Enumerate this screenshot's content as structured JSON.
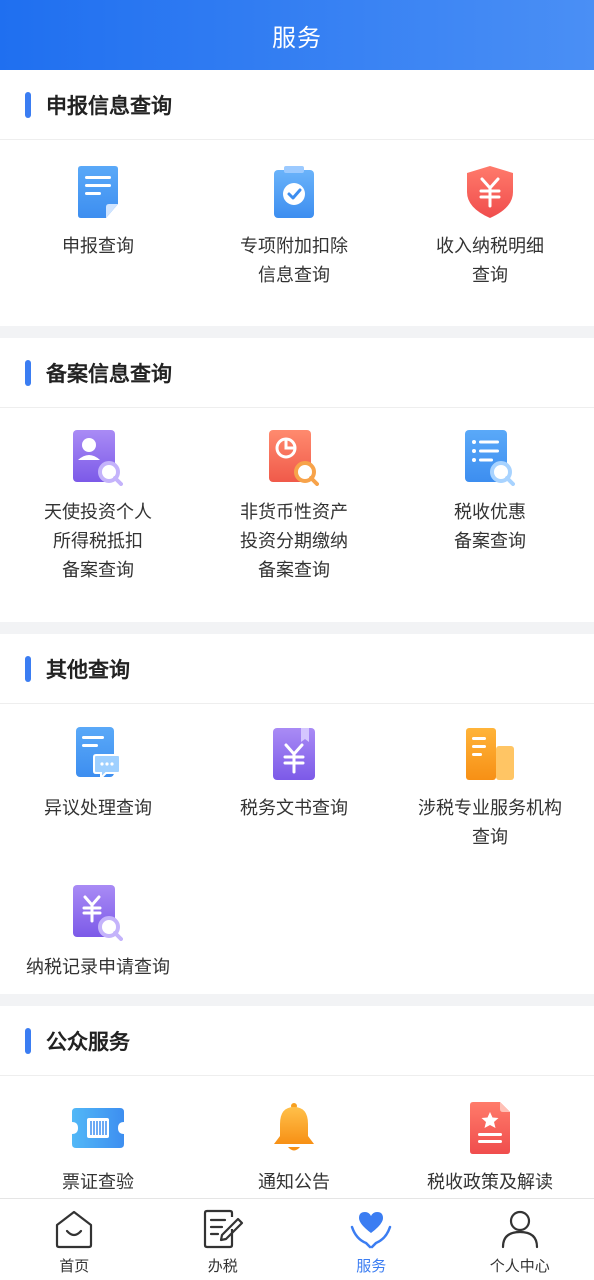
{
  "header": {
    "title": "服务"
  },
  "sections": [
    {
      "title": "申报信息查询",
      "items": [
        {
          "label": "申报查询",
          "icon": "document-icon"
        },
        {
          "label": "专项附加扣除\n信息查询",
          "icon": "clipboard-check-icon"
        },
        {
          "label": "收入纳税明细\n查询",
          "icon": "yuan-shield-icon"
        }
      ]
    },
    {
      "title": "备案信息查询",
      "items": [
        {
          "label": "天使投资个人\n所得税抵扣\n备案查询",
          "icon": "person-search-icon"
        },
        {
          "label": "非货币性资产\n投资分期缴纳\n备案查询",
          "icon": "pie-search-icon"
        },
        {
          "label": "税收优惠\n备案查询",
          "icon": "list-search-icon"
        }
      ]
    },
    {
      "title": "其他查询",
      "items": [
        {
          "label": "异议处理查询",
          "icon": "message-doc-icon"
        },
        {
          "label": "税务文书查询",
          "icon": "yuan-book-icon"
        },
        {
          "label": "涉税专业服务机构\n查询",
          "icon": "building-icon"
        },
        {
          "label": "纳税记录申请查询",
          "icon": "yuan-search-icon"
        }
      ]
    },
    {
      "title": "公众服务",
      "items": [
        {
          "label": "票证查验",
          "icon": "barcode-ticket-icon"
        },
        {
          "label": "通知公告",
          "icon": "bell-icon"
        },
        {
          "label": "税收政策及解读",
          "icon": "star-document-icon"
        }
      ]
    }
  ],
  "tabbar": [
    {
      "label": "首页",
      "icon": "home-icon"
    },
    {
      "label": "办税",
      "icon": "edit-doc-icon"
    },
    {
      "label": "服务",
      "icon": "heart-hands-icon",
      "active": true
    },
    {
      "label": "个人中心",
      "icon": "user-icon"
    }
  ],
  "colors": {
    "primary": "#3b7df2",
    "header_start": "#1f6ff0",
    "header_end": "#4a8ff5"
  }
}
